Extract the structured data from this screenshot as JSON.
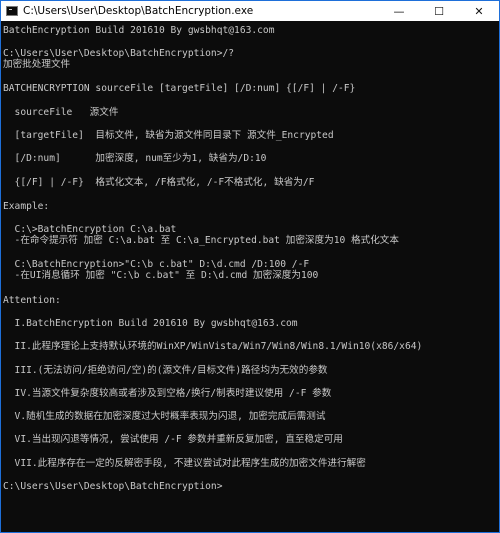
{
  "window": {
    "title": "C:\\Users\\User\\Desktop\\BatchEncryption.exe",
    "minimize": "—",
    "maximize": "☐",
    "close": "✕"
  },
  "console": {
    "lines": [
      "BatchEncryption Build 201610 By gwsbhqt@163.com",
      "C:\\Users\\User\\Desktop\\BatchEncryption>/?",
      "加密批处理文件",
      "BATCHENCRYPTION sourceFile [targetFile] [/D:num] {[/F] | /-F}",
      "  sourceFile   源文件",
      "  [targetFile]  目标文件, 缺省为源文件同目录下 源文件_Encrypted",
      "  [/D:num]      加密深度, num至少为1, 缺省为/D:10",
      "  {[/F] | /-F}  格式化文本, /F格式化, /-F不格式化, 缺省为/F",
      "Example:",
      "  C:\\>BatchEncryption C:\\a.bat",
      "  -在命令提示符 加密 C:\\a.bat 至 C:\\a_Encrypted.bat 加密深度为10 格式化文本",
      "  C:\\BatchEncryption>\"C:\\b c.bat\" D:\\d.cmd /D:100 /-F",
      "  -在UI消息循环 加密 \"C:\\b c.bat\" 至 D:\\d.cmd 加密深度为100",
      "Attention:",
      "  I.BatchEncryption Build 201610 By gwsbhqt@163.com",
      "  II.此程序理论上支持默认环境的WinXP/WinVista/Win7/Win8/Win8.1/Win10(x86/x64)",
      "  III.(无法访问/拒绝访问/空)的(源文件/目标文件)路径均为无效的参数",
      "  IV.当源文件复杂度较高或者涉及到空格/换行/制表时建议使用 /-F 参数",
      "  V.随机生成的数据在加密深度过大时概率表现为闪退, 加密完成后需测试",
      "  VI.当出现闪退等情况, 尝试使用 /-F 参数并重新反复加密, 直至稳定可用",
      "  VII.此程序存在一定的反解密手段, 不建议尝试对此程序生成的加密文件进行解密",
      "C:\\Users\\User\\Desktop\\BatchEncryption>"
    ]
  }
}
